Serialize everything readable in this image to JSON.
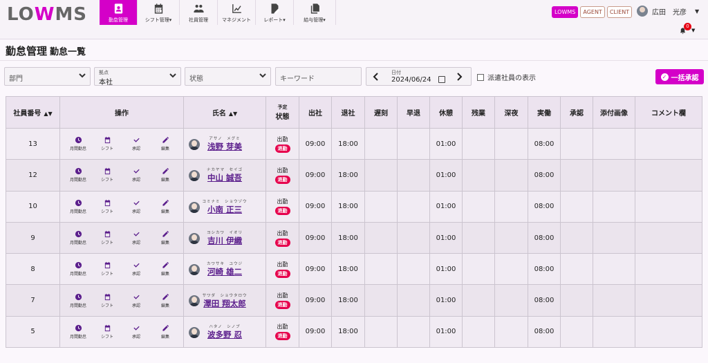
{
  "logo": {
    "pre": "LO",
    "w": "W",
    "post": "MS"
  },
  "nav": [
    {
      "label": "勤怠管理",
      "icon": "badge-icon",
      "active": true
    },
    {
      "label": "シフト管理▾",
      "icon": "calendar-icon"
    },
    {
      "label": "社員管理",
      "icon": "users-icon"
    },
    {
      "label": "マネジメント",
      "icon": "chart-line-icon"
    },
    {
      "label": "レポート▾",
      "icon": "report-icon"
    },
    {
      "label": "給与管理▾",
      "icon": "copy-icon"
    }
  ],
  "roles": [
    "LOWMS",
    "AGENT",
    "CLIENT"
  ],
  "user": {
    "name": "広田　光彦"
  },
  "notifications": {
    "count": "0"
  },
  "page": {
    "title": "勤怠管理",
    "subtitle": "勤怠一覧"
  },
  "filters": {
    "department": "部門",
    "base_label": "拠点",
    "base_value": "本社",
    "status": "状態",
    "keyword_placeholder": "キーワード",
    "date_label": "日付",
    "date_value": "2024/06/24",
    "dispatch_label": "派遣社員の表示",
    "approve_all": "一括承認"
  },
  "columns": {
    "emp_no": "社員番号",
    "ops": "操作",
    "name": "氏名",
    "yotei": "予定",
    "status": "状態",
    "in": "出社",
    "out": "退社",
    "late": "遅刻",
    "early": "早退",
    "break": "休憩",
    "overtime": "残業",
    "night": "深夜",
    "actual": "実働",
    "approve": "承認",
    "image": "添付画像",
    "comment": "コメント欄"
  },
  "op_labels": [
    "月間勤怠",
    "シフト",
    "承認",
    "編集"
  ],
  "status_labels": {
    "scheduled": "出勤",
    "state": "退勤"
  },
  "rows": [
    {
      "no": "13",
      "kana": "アサノ　メグミ",
      "name": "浅野 芽美",
      "in": "09:00",
      "out": "18:00",
      "break": "01:00",
      "actual": "08:00"
    },
    {
      "no": "12",
      "kana": "ナカヤマ　セイゴ",
      "name": "中山 誠吾",
      "in": "09:00",
      "out": "18:00",
      "break": "01:00",
      "actual": "08:00"
    },
    {
      "no": "10",
      "kana": "コミナミ　ショウゾウ",
      "name": "小南 正三",
      "in": "09:00",
      "out": "18:00",
      "break": "01:00",
      "actual": "08:00"
    },
    {
      "no": "9",
      "kana": "ヨシカワ　イオリ",
      "name": "吉川 伊織",
      "in": "09:00",
      "out": "18:00",
      "break": "01:00",
      "actual": "08:00"
    },
    {
      "no": "8",
      "kana": "カワサキ　ユウジ",
      "name": "河崎 雄二",
      "in": "09:00",
      "out": "18:00",
      "break": "01:00",
      "actual": "08:00"
    },
    {
      "no": "7",
      "kana": "サワダ　ショウタロウ",
      "name": "澤田 翔太郎",
      "in": "09:00",
      "out": "18:00",
      "break": "01:00",
      "actual": "08:00"
    },
    {
      "no": "5",
      "kana": "ハタノ　シノブ",
      "name": "波多野 忍",
      "in": "09:00",
      "out": "18:00",
      "break": "01:00",
      "actual": "08:00"
    }
  ],
  "colors": {
    "accent": "#d400c8",
    "icon": "#5b1e8c",
    "badge": "#e6004c"
  }
}
